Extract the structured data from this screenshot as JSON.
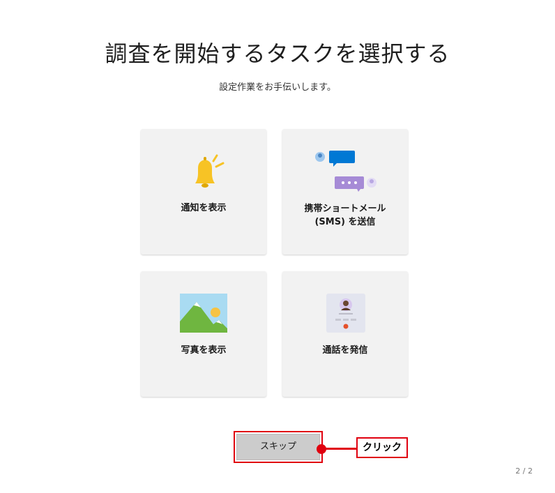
{
  "header": {
    "title": "調査を開始するタスクを選択する",
    "subtitle": "設定作業をお手伝いします。"
  },
  "tasks": [
    {
      "label": "通知を表示",
      "icon": "bell-icon"
    },
    {
      "label_line1": "携帯ショートメール",
      "label_line2": "(SMS) を送信",
      "icon": "chat-bubbles-icon"
    },
    {
      "label": "写真を表示",
      "icon": "mountain-photo-icon"
    },
    {
      "label": "通話を発信",
      "icon": "phone-dialer-icon"
    }
  ],
  "footer": {
    "skip_label": "スキップ",
    "callout_label": "クリック",
    "page_indicator": "2 / 2"
  },
  "colors": {
    "highlight": "#e0000f",
    "card_bg": "#f2f2f2",
    "bell": "#f7c325",
    "bubble_blue": "#0078d4",
    "bubble_purple": "#a68bd6"
  }
}
